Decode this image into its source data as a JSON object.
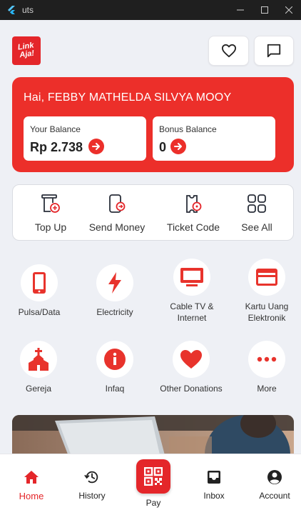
{
  "window": {
    "title": "uts"
  },
  "brand": {
    "logo_text": "Link Aja!",
    "accent": "#e4262a"
  },
  "header": {
    "greeting": "Hai, FEBBY MATHELDA SILVYA MOOY"
  },
  "balance": {
    "main_label": "Your Balance",
    "main_value": "Rp 2.738",
    "bonus_label": "Bonus Balance",
    "bonus_value": "0"
  },
  "quick_actions": [
    {
      "label": "Top Up",
      "icon": "top-up-icon"
    },
    {
      "label": "Send Money",
      "icon": "send-money-icon"
    },
    {
      "label": "Ticket Code",
      "icon": "ticket-code-icon"
    },
    {
      "label": "See All",
      "icon": "grid-icon"
    }
  ],
  "services": [
    {
      "label": "Pulsa/Data",
      "icon": "phone-icon"
    },
    {
      "label": "Electricity",
      "icon": "lightning-icon"
    },
    {
      "label": "Cable TV & Internet",
      "icon": "tv-icon"
    },
    {
      "label": "Kartu Uang Elektronik",
      "icon": "card-icon"
    },
    {
      "label": "Gereja",
      "icon": "church-icon"
    },
    {
      "label": "Infaq",
      "icon": "info-icon"
    },
    {
      "label": "Other Donations",
      "icon": "heart-icon"
    },
    {
      "label": "More",
      "icon": "more-icon"
    }
  ],
  "nav": {
    "home": "Home",
    "history": "History",
    "pay": "Pay",
    "inbox": "Inbox",
    "account": "Account"
  }
}
